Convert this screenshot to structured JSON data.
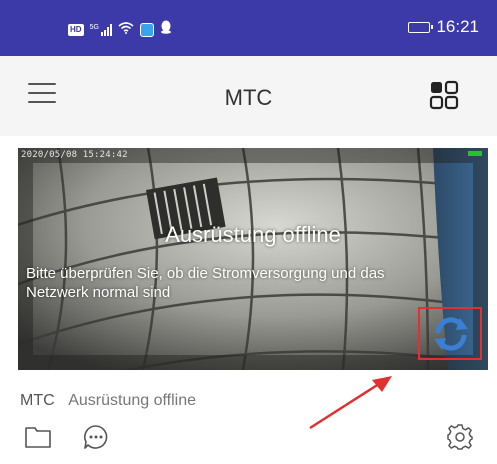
{
  "status_bar": {
    "hd_label": "HD",
    "network_label": "5G",
    "time": "16:21",
    "icons": [
      "hd-icon",
      "signal-icon",
      "wifi-icon",
      "app-notification-icon",
      "qq-icon",
      "battery-icon"
    ]
  },
  "app_bar": {
    "title": "MTC",
    "menu_icon": "hamburger-icon",
    "grid_icon": "grid-view-icon"
  },
  "video": {
    "timestamp": "2020/05/08 15:24:42",
    "offline_title": "Ausrüstung offline",
    "offline_message": "Bitte überprüfen Sie, ob die Stromversorgung und das Netzwerk normal sind",
    "refresh_icon": "refresh-icon",
    "signal_color": "#26c12f",
    "highlight_color": "#e03030"
  },
  "device": {
    "name": "MTC",
    "status": "Ausrüstung offline"
  },
  "bottom_icons": [
    "folder-icon",
    "message-icon",
    "settings-icon"
  ],
  "colors": {
    "status_bar": "#3c3aa8",
    "app_bar": "#f5f5f5",
    "annotation_arrow": "#e03030"
  }
}
